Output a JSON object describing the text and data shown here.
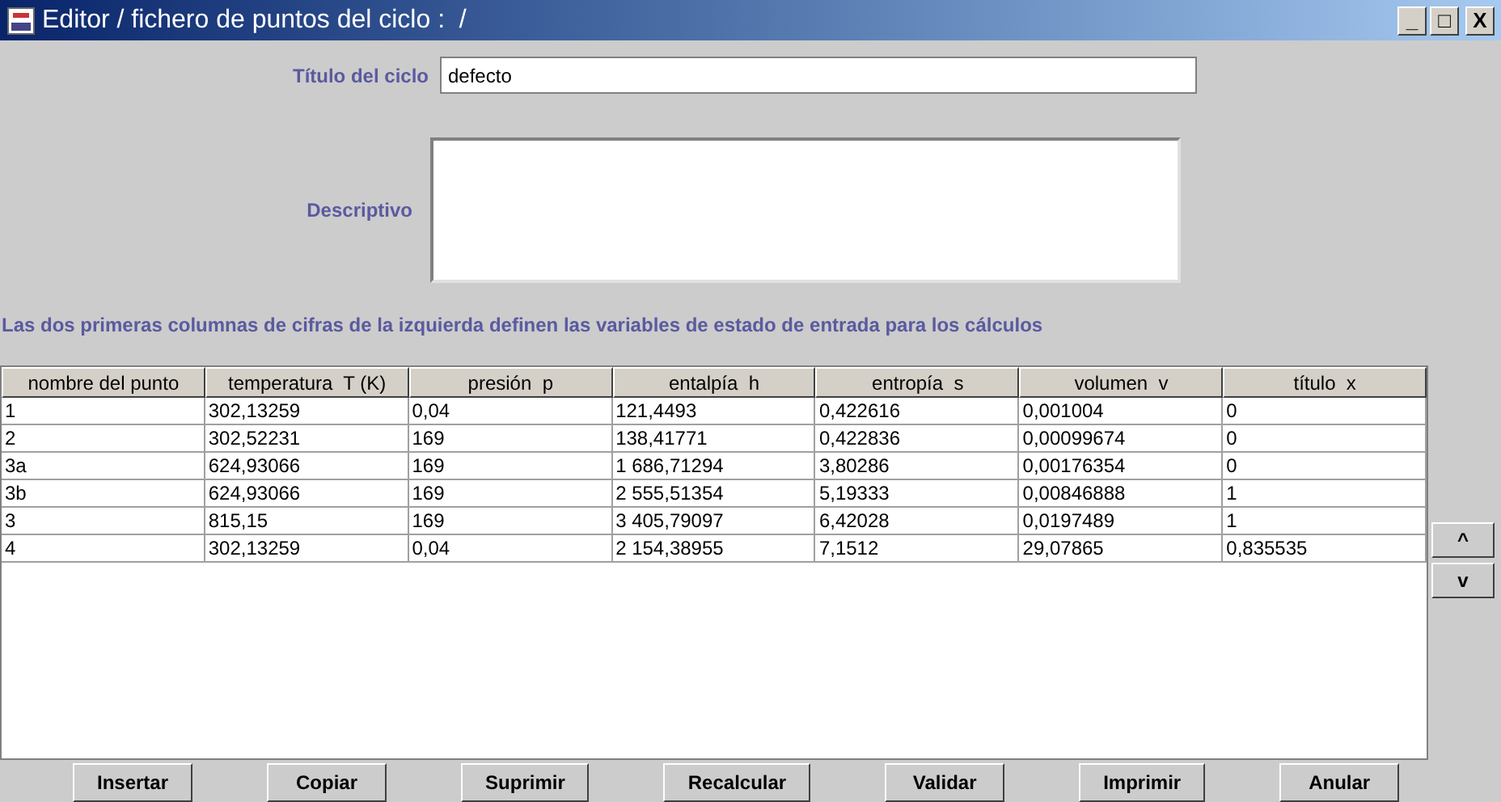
{
  "window": {
    "title": "Editor / fichero de puntos del ciclo :  /",
    "controls": [
      "_",
      "□",
      "X"
    ]
  },
  "form": {
    "title_label": "Título del ciclo",
    "title_value": "defecto",
    "description_label": "Descriptivo"
  },
  "info": "Las dos primeras columnas de cifras de la izquierda definen las variables de estado de entrada para los cálculos",
  "table": {
    "columns": [
      "nombre del punto",
      "temperatura  T (K)",
      "presión  p",
      "entalpía  h",
      "entropía  s",
      "volumen  v",
      "título  x"
    ],
    "rows": [
      [
        "1",
        "302,13259",
        "0,04",
        "121,4493",
        "0,422616",
        "0,001004",
        "0"
      ],
      [
        "2",
        "302,52231",
        "169",
        "138,41771",
        "0,422836",
        "0,00099674",
        "0"
      ],
      [
        "3a",
        "624,93066",
        "169",
        "1 686,71294",
        "3,80286",
        "0,00176354",
        "0"
      ],
      [
        "3b",
        "624,93066",
        "169",
        "2 555,51354",
        "5,19333",
        "0,00846888",
        "1"
      ],
      [
        "3",
        "815,15",
        "169",
        "3 405,79097",
        "6,42028",
        "0,0197489",
        "1"
      ],
      [
        "4",
        "302,13259",
        "0,04",
        "2 154,38955",
        "7,1512",
        "29,07865",
        "0,835535"
      ]
    ]
  },
  "move_buttons": [
    "^",
    "v"
  ],
  "buttons": [
    "Insertar",
    "Copiar",
    "Suprimir",
    "Recalcular",
    "Validar",
    "Imprimir",
    "Anular"
  ]
}
